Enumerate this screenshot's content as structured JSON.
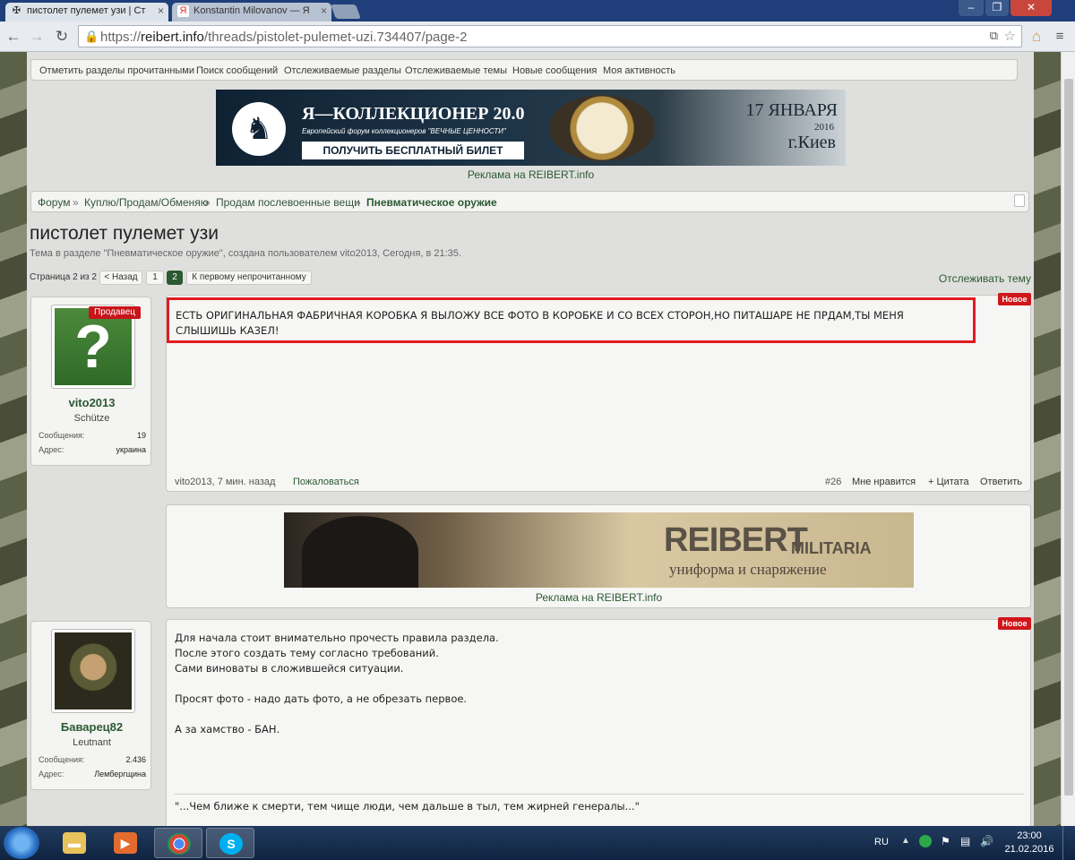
{
  "browser": {
    "tabs": [
      {
        "title": "пистолет пулемет узи | Ст",
        "icon": "✠"
      },
      {
        "title": "Konstantin Milovanov — Я",
        "icon": "Я"
      }
    ],
    "url_scheme": "https://",
    "url_host": "reibert.info",
    "url_path": "/threads/pistolet-pulemet-uzi.734407/page-2"
  },
  "nav_links": [
    "Отметить разделы прочитанными",
    "Поиск сообщений",
    "Отслеживаемые разделы",
    "Отслеживаемые темы",
    "Новые сообщения",
    "Моя активность"
  ],
  "banner1": {
    "title": "Я—КОЛЛЕКЦИОНЕР 20.0",
    "subtitle": "Европейский форум коллекционеров \"ВЕЧНЫЕ ЦЕННОСТИ\"",
    "cta": "ПОЛУЧИТЬ БЕСПЛАТНЫЙ БИЛЕТ",
    "date": "17 ЯНВАРЯ",
    "year": "2016",
    "city": "г.Киев",
    "caption": "Реклама на REIBERT.info"
  },
  "breadcrumbs": [
    "Форум",
    "Куплю/Продам/Обменяю",
    "Продам послевоенные вещи",
    "Пневматическое оружие"
  ],
  "breadcrumb_sep": "»",
  "thread": {
    "title": "пистолет пулемет узи",
    "meta": "Тема в разделе \"Пневматическое оружие\", создана пользователем vito2013, Сегодня, в 21:35."
  },
  "pagination": {
    "label": "Страница 2 из 2",
    "prev": "< Назад",
    "pages": [
      "1",
      "2"
    ],
    "first_unread": "К первому непрочитанному",
    "watch": "Отслеживать тему"
  },
  "posts": [
    {
      "user": "vito2013",
      "badge": "Продавец",
      "rank": "Schütze",
      "stat_labels": [
        "Сообщения:",
        "Адрес:"
      ],
      "stat_values": [
        "19",
        "украина"
      ],
      "new_label": "Новое",
      "text_lines": [
        "ЕСТЬ ОРИГИНАЛЬНАЯ ФАБРИЧНАЯ КОРОБКА Я ВЫЛОЖУ ВСЕ ФОТО В КОРОБКЕ И СО ВСЕХ СТОРОН,НО ПИТАШАРЕ НЕ ПРДАМ,ТЫ МЕНЯ",
        "СЛЫШИШЬ КАЗЕЛ!"
      ],
      "meta": "vito2013, 7 мин. назад",
      "report": "Пожаловаться",
      "number": "#26",
      "like": "Мне нравится",
      "quote": "+ Цитата",
      "reply": "Ответить"
    },
    {
      "user": "Баварец82",
      "rank": "Leutnant",
      "stat_labels": [
        "Сообщения:",
        "Адрес:"
      ],
      "stat_values": [
        "2.436",
        "Лембергщина"
      ],
      "new_label": "Новое",
      "text_lines": [
        "Для начала стоит внимательно прочесть правила раздела.",
        "После этого создать тему согласно требований.",
        "Сами виноваты в сложившейся ситуации.",
        "",
        "Просят фото - надо дать фото, а не обрезать первое.",
        "",
        "А за хамство - БАН."
      ],
      "signature": "\"...Чем ближе к смерти, тем чище люди, чем дальше в тыл, тем жирней генералы...\""
    }
  ],
  "banner2": {
    "brand": "REIBERT",
    "brand_sub": "MILITARIA",
    "tagline": "униформа и снаряжение",
    "caption": "Реклама на REIBERT.info"
  },
  "taskbar": {
    "lang": "RU",
    "time": "23:00",
    "date": "21.02.2016"
  },
  "colors": {
    "accent_green": "#2b5a32",
    "alert_red": "#d0161a",
    "taskbar": "#1a3152"
  }
}
